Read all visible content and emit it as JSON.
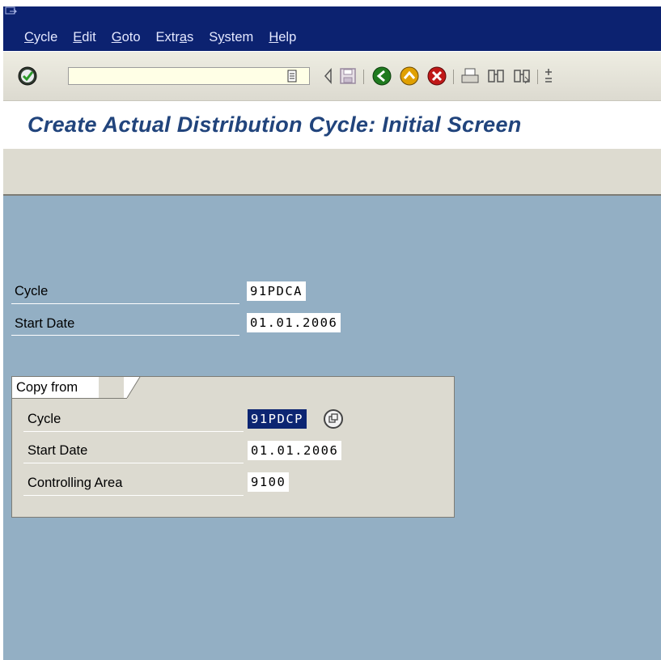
{
  "menu": {
    "items": [
      {
        "label": "Cycle",
        "u": "C",
        "rest": "ycle"
      },
      {
        "label": "Edit",
        "u": "E",
        "rest": "dit"
      },
      {
        "label": "Goto",
        "u": "G",
        "rest": "oto"
      },
      {
        "label": "Extras",
        "pre": "Extr",
        "u": "a",
        "rest": "s"
      },
      {
        "label": "System",
        "pre": "S",
        "u": "y",
        "rest": "stem"
      },
      {
        "label": "Help",
        "u": "H",
        "rest": "elp"
      }
    ]
  },
  "toolbar": {
    "command_field_value": "",
    "icons": [
      "enter-icon",
      "command-field-dropdown-icon",
      "back-triangle-icon",
      "save-icon",
      "back-icon",
      "exit-icon",
      "cancel-icon",
      "print-icon",
      "find-icon",
      "find-next-icon",
      "first-page-icon"
    ]
  },
  "title": "Create Actual Distribution Cycle: Initial Screen",
  "form": {
    "cycle_label": "Cycle",
    "cycle_value": "91PDCA",
    "start_date_label": "Start Date",
    "start_date_value": "01.01.2006",
    "copy_from": {
      "title": "Copy from",
      "cycle_label": "Cycle",
      "cycle_value": "91PDCP",
      "start_date_label": "Start Date",
      "start_date_value": "01.01.2006",
      "controlling_area_label": "Controlling Area",
      "controlling_area_value": "9100"
    }
  },
  "colors": {
    "menubar": "#0c2270",
    "content_background": "#93afc4",
    "title_color": "#21447c",
    "focus_field": "#0c2572"
  }
}
